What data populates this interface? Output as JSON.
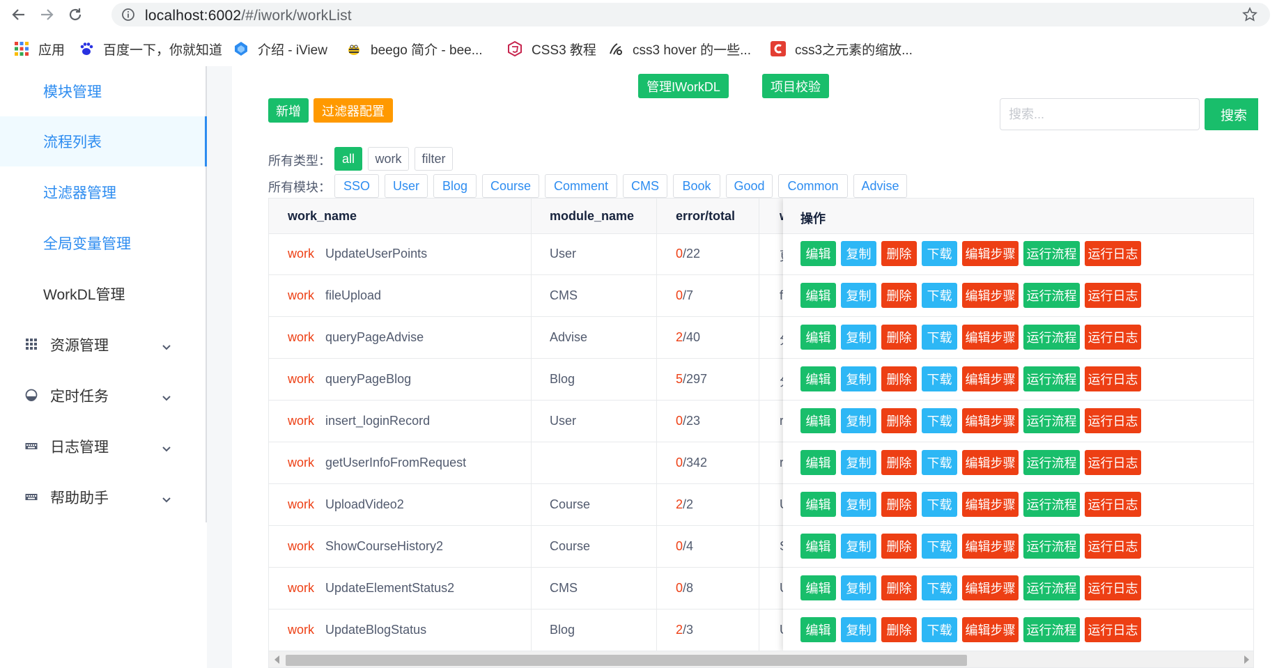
{
  "browser": {
    "url_host": "localhost:6002",
    "url_path": "/#/iwork/workList",
    "bookmarks": [
      {
        "label": "应用",
        "icon": "apps-grid-icon"
      },
      {
        "label": "百度一下，你就知道",
        "icon": "baidu-paw-icon"
      },
      {
        "label": "介绍 - iView",
        "icon": "iview-logo-icon"
      },
      {
        "label": "beego 简介 - bee...",
        "icon": "beego-logo-icon"
      },
      {
        "label": "CSS3 教程",
        "icon": "runoob-logo-icon"
      },
      {
        "label": "css3 hover 的一些...",
        "icon": "cnblogs-logo-icon"
      },
      {
        "label": "css3之元素的缩放...",
        "icon": "csdn-logo-icon"
      }
    ]
  },
  "sidebar": {
    "items": [
      {
        "label": "模块管理",
        "state": "link"
      },
      {
        "label": "流程列表",
        "state": "active"
      },
      {
        "label": "过滤器管理",
        "state": "link"
      },
      {
        "label": "全局变量管理",
        "state": "link"
      },
      {
        "label": "WorkDL管理",
        "state": "plain"
      }
    ],
    "submenus": [
      {
        "label": "资源管理",
        "icon": "grid-icon"
      },
      {
        "label": "定时任务",
        "icon": "dial-icon"
      },
      {
        "label": "日志管理",
        "icon": "keyboard-icon"
      },
      {
        "label": "帮助助手",
        "icon": "keyboard-icon"
      }
    ]
  },
  "toolbar": {
    "manage_workdl": "管理IWorkDL",
    "project_check": "项目校验",
    "add": "新增",
    "filter_config": "过滤器配置",
    "search_placeholder": "搜索...",
    "search": "搜索"
  },
  "filters": {
    "type_label": "所有类型：",
    "types": [
      "all",
      "work",
      "filter"
    ],
    "selected_type": "all",
    "module_label": "所有模块：",
    "modules": [
      "SSO",
      "User",
      "Blog",
      "Course",
      "Comment",
      "CMS",
      "Book",
      "Good",
      "Common",
      "Advise"
    ]
  },
  "table": {
    "columns": [
      "work_name",
      "module_name",
      "error/total",
      "w",
      "操作"
    ],
    "rows": [
      {
        "type": "work",
        "name": "UpdateUserPoints",
        "module": "User",
        "errors": "0",
        "total": "/22",
        "w": "更"
      },
      {
        "type": "work",
        "name": "fileUpload",
        "module": "CMS",
        "errors": "0",
        "total": "/7",
        "w": "fi"
      },
      {
        "type": "work",
        "name": "queryPageAdvise",
        "module": "Advise",
        "errors": "2",
        "total": "/40",
        "w": "分"
      },
      {
        "type": "work",
        "name": "queryPageBlog",
        "module": "Blog",
        "errors": "5",
        "total": "/297",
        "w": "分"
      },
      {
        "type": "work",
        "name": "insert_loginRecord",
        "module": "User",
        "errors": "0",
        "total": "/23",
        "w": "re"
      },
      {
        "type": "work",
        "name": "getUserInfoFromRequest",
        "module": "",
        "errors": "0",
        "total": "/342",
        "w": "re"
      },
      {
        "type": "work",
        "name": "UploadVideo2",
        "module": "Course",
        "errors": "2",
        "total": "/2",
        "w": "U"
      },
      {
        "type": "work",
        "name": "ShowCourseHistory2",
        "module": "Course",
        "errors": "0",
        "total": "/4",
        "w": "S"
      },
      {
        "type": "work",
        "name": "UpdateElementStatus2",
        "module": "CMS",
        "errors": "0",
        "total": "/8",
        "w": "U"
      },
      {
        "type": "work",
        "name": "UpdateBlogStatus",
        "module": "Blog",
        "errors": "2",
        "total": "/3",
        "w": "U"
      }
    ],
    "actions": [
      "编辑",
      "复制",
      "删除",
      "下载",
      "编辑步骤",
      "运行流程",
      "运行日志"
    ]
  }
}
